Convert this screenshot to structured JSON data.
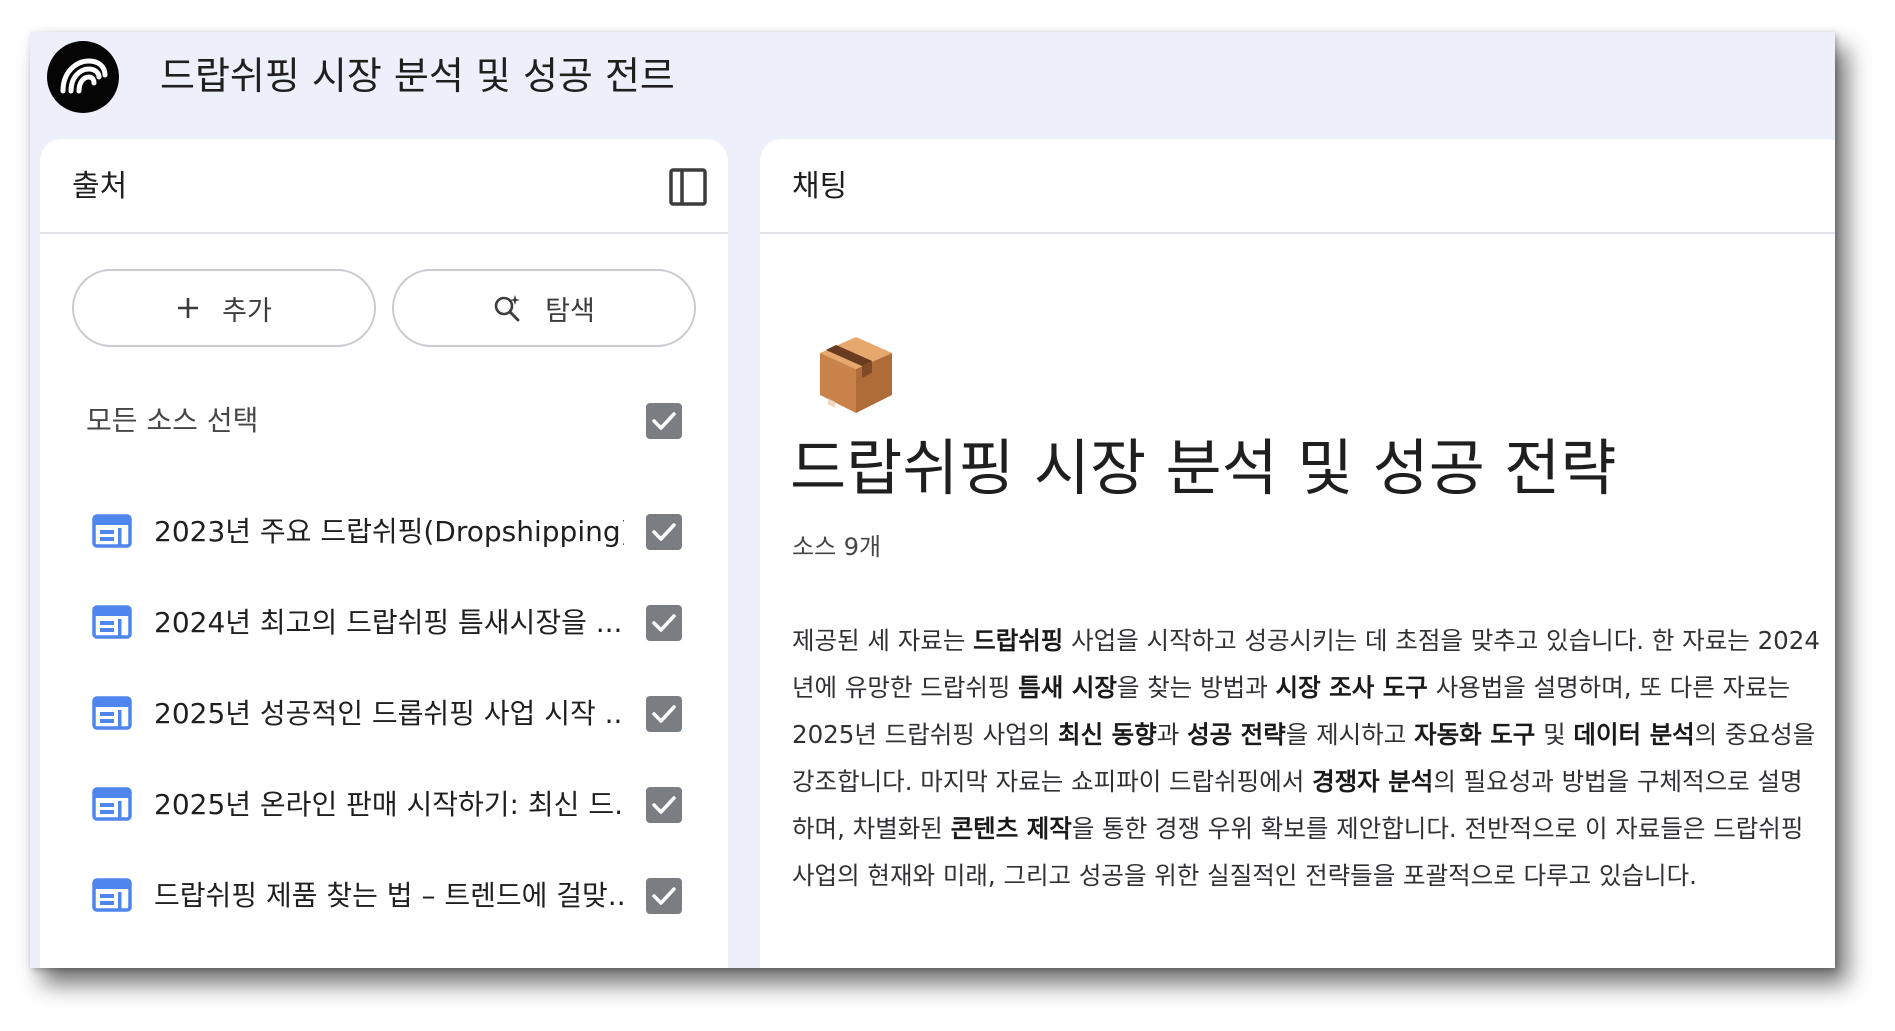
{
  "app": {
    "title": "드랍쉬핑 시장 분석 및 성공 전르"
  },
  "sources_panel": {
    "title": "출처",
    "toggle_icon": "sidebar-toggle-icon",
    "add_label": "추가",
    "explore_label": "탐색",
    "select_all_label": "모든 소스 선택",
    "select_all_checked": true,
    "items": [
      {
        "label": "2023년 주요 드랍쉬핑(Dropshipping)...",
        "checked": true,
        "icon": "web-page-icon"
      },
      {
        "label": "2024년 최고의 드랍쉬핑 틈새시장을 ...",
        "checked": true,
        "icon": "web-page-icon"
      },
      {
        "label": "2025년 성공적인 드롭쉬핑 사업 시작 ...",
        "checked": true,
        "icon": "web-page-icon"
      },
      {
        "label": "2025년 온라인 판매 시작하기: 최신 드...",
        "checked": true,
        "icon": "web-page-icon"
      },
      {
        "label": "드랍쉬핑 제품 찾는 법 – 트렌드에 걸맞...",
        "checked": true,
        "icon": "web-page-icon"
      }
    ]
  },
  "chat_panel": {
    "title": "채팅",
    "emoji": "package-emoji",
    "doc_title": "드랍쉬핑 시장 분석 및 성공 전략",
    "source_count": "소스 9개",
    "summary": [
      {
        "t": "제공된 세 자료는 ",
        "b": false
      },
      {
        "t": "드랍쉬핑",
        "b": true
      },
      {
        "t": " 사업을 시작하고 성공시키는 데 초점을 맞추고 있습니다. 한 자료는 2024년에 유망한 드랍쉬핑 ",
        "b": false
      },
      {
        "t": "틈새 시장",
        "b": true
      },
      {
        "t": "을 찾는 방법과 ",
        "b": false
      },
      {
        "t": "시장 조사 도구",
        "b": true
      },
      {
        "t": " 사용법을 설명하며, 또 다른 자료는 2025년 드랍쉬핑 사업의 ",
        "b": false
      },
      {
        "t": "최신 동향",
        "b": true
      },
      {
        "t": "과 ",
        "b": false
      },
      {
        "t": "성공 전략",
        "b": true
      },
      {
        "t": "을 제시하고 ",
        "b": false
      },
      {
        "t": "자동화 도구",
        "b": true
      },
      {
        "t": " 및 ",
        "b": false
      },
      {
        "t": "데이터 분석",
        "b": true
      },
      {
        "t": "의 중요성을 강조합니다. 마지막 자료는 쇼피파이 드랍쉬핑에서 ",
        "b": false
      },
      {
        "t": "경쟁자 분석",
        "b": true
      },
      {
        "t": "의 필요성과 방법을 구체적으로 설명하며, 차별화된 ",
        "b": false
      },
      {
        "t": "콘텐츠 제작",
        "b": true
      },
      {
        "t": "을 통한 경쟁 우위 확보를 제안합니다. 전반적으로 이 자료들은 드랍쉬핑 사업의 현재와 미래, 그리고 성공을 위한 실질적인 전략들을 포괄적으로 다루고 있습니다.",
        "b": false
      }
    ]
  }
}
